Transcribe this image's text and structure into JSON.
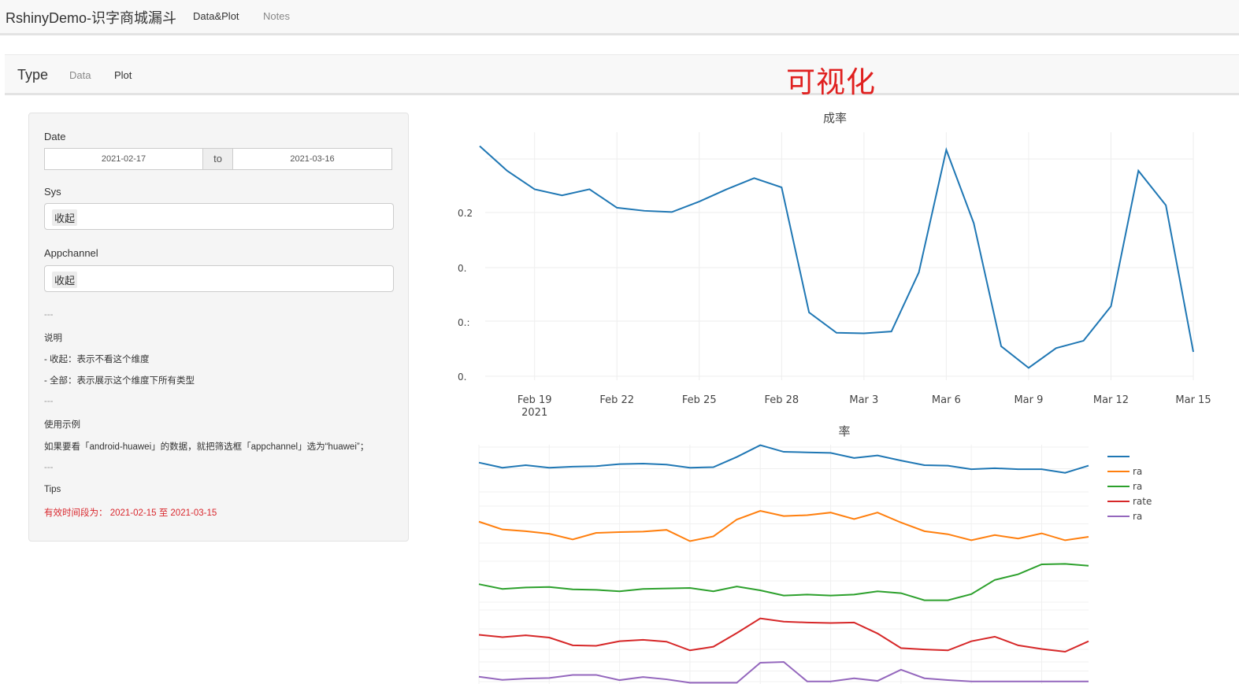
{
  "app": {
    "title": "RshinyDemo-识字商城漏斗",
    "nav": {
      "data_plot": "Data&Plot",
      "notes": "Notes"
    }
  },
  "subnav": {
    "brand": "Type",
    "tabs": {
      "data": "Data",
      "plot": "Plot"
    }
  },
  "page_heading": "可视化",
  "sidebar": {
    "date_label": "Date",
    "date_start": "2021-02-17",
    "date_sep": "to",
    "date_end": "2021-03-16",
    "sys_label": "Sys",
    "sys_value": "收起",
    "appchannel_label": "Appchannel",
    "appchannel_value": "收起",
    "hr1": "---",
    "note_title": "说明",
    "note_line1": "- 收起：表示不看这个维度",
    "note_line2": "- 全部：表示展示这个维度下所有类型",
    "hr2": "---",
    "example_title": "使用示例",
    "example_line": "如果要看「android-huawei」的数据，就把筛选框「appchannel」选为“huawei”；",
    "hr3": "---",
    "tips_title": "Tips",
    "tips_line": "有效时间段为： 2021-02-15 至 2021-03-15"
  },
  "colors": {
    "accent_red": "#e0201f",
    "series_blue": "#1f77b4",
    "series_orange": "#ff7f0e",
    "series_green": "#2ca02c",
    "series_red": "#d62728",
    "series_purple": "#9467bd"
  },
  "chart_data": [
    {
      "type": "line",
      "title": "",
      "title_visible_fragment": "成率",
      "x": [
        "2021-02-17",
        "2021-02-18",
        "2021-02-19",
        "2021-02-20",
        "2021-02-21",
        "2021-02-22",
        "2021-02-23",
        "2021-02-24",
        "2021-02-25",
        "2021-02-26",
        "2021-02-27",
        "2021-02-28",
        "2021-03-01",
        "2021-03-02",
        "2021-03-03",
        "2021-03-04",
        "2021-03-05",
        "2021-03-06",
        "2021-03-07",
        "2021-03-08",
        "2021-03-09",
        "2021-03-10",
        "2021-03-11",
        "2021-03-12",
        "2021-03-13",
        "2021-03-14",
        "2021-03-15"
      ],
      "x_tick_labels": [
        "Feb 19\n2021",
        "Feb 22",
        "Feb 25",
        "Feb 28",
        "Mar 3",
        "Mar 6",
        "Mar 9",
        "Mar 12",
        "Mar 15"
      ],
      "y_tick_labels": [
        "0.2",
        "0.",
        "0.:",
        "0."
      ],
      "series": [
        {
          "color": "#1f77b4",
          "values": [
            0.98,
            0.94,
            0.91,
            0.9,
            0.91,
            0.88,
            0.875,
            0.873,
            0.89,
            0.91,
            0.928,
            0.913,
            0.71,
            0.677,
            0.676,
            0.679,
            0.775,
            0.974,
            0.855,
            0.655,
            0.62,
            0.652,
            0.664,
            0.72,
            0.94,
            0.884,
            0.646
          ]
        }
      ],
      "grid": true
    },
    {
      "type": "line",
      "title": "",
      "title_visible_fragment": "率",
      "x": [
        "2021-02-17",
        "2021-02-18",
        "2021-02-19",
        "2021-02-20",
        "2021-02-21",
        "2021-02-22",
        "2021-02-23",
        "2021-02-24",
        "2021-02-25",
        "2021-02-26",
        "2021-02-27",
        "2021-02-28",
        "2021-03-01",
        "2021-03-02",
        "2021-03-03",
        "2021-03-04",
        "2021-03-05",
        "2021-03-06",
        "2021-03-07",
        "2021-03-08",
        "2021-03-09",
        "2021-03-10",
        "2021-03-11",
        "2021-03-12",
        "2021-03-13",
        "2021-03-14",
        "2021-03-15"
      ],
      "legend_placement": "top-right",
      "legend_fragments": [
        "ra",
        "ra",
        "rate",
        "ra"
      ],
      "subplots": 5,
      "series": [
        {
          "color": "#1f77b4",
          "values": [
            0.62,
            0.52,
            0.57,
            0.52,
            0.54,
            0.55,
            0.59,
            0.6,
            0.58,
            0.52,
            0.53,
            0.73,
            0.96,
            0.83,
            0.82,
            0.81,
            0.71,
            0.76,
            0.66,
            0.57,
            0.56,
            0.49,
            0.51,
            0.49,
            0.49,
            0.42,
            0.56
          ]
        },
        {
          "color": "#ff7f0e",
          "values": [
            0.55,
            0.37,
            0.33,
            0.27,
            0.14,
            0.29,
            0.31,
            0.32,
            0.36,
            0.1,
            0.21,
            0.6,
            0.8,
            0.68,
            0.7,
            0.76,
            0.61,
            0.76,
            0.53,
            0.33,
            0.26,
            0.12,
            0.24,
            0.16,
            0.28,
            0.12,
            0.2
          ]
        },
        {
          "color": "#2ca02c",
          "values": [
            0.43,
            0.33,
            0.36,
            0.37,
            0.32,
            0.31,
            0.28,
            0.33,
            0.34,
            0.35,
            0.28,
            0.38,
            0.3,
            0.19,
            0.21,
            0.19,
            0.21,
            0.28,
            0.24,
            0.09,
            0.09,
            0.22,
            0.52,
            0.64,
            0.85,
            0.86,
            0.82
          ]
        },
        {
          "color": "#d62728",
          "values": [
            0.37,
            0.32,
            0.36,
            0.31,
            0.14,
            0.13,
            0.23,
            0.26,
            0.22,
            0.03,
            0.11,
            0.41,
            0.73,
            0.66,
            0.64,
            0.63,
            0.64,
            0.4,
            0.08,
            0.05,
            0.03,
            0.23,
            0.33,
            0.14,
            0.06,
            0.0,
            0.23
          ]
        },
        {
          "color": "#9467bd",
          "values": [
            0.28,
            0.16,
            0.21,
            0.23,
            0.35,
            0.35,
            0.15,
            0.27,
            0.18,
            0.05,
            0.05,
            0.05,
            0.82,
            0.85,
            0.1,
            0.1,
            0.22,
            0.12,
            0.55,
            0.22,
            0.15,
            0.1,
            0.1,
            0.1,
            0.1,
            0.1,
            0.1
          ]
        }
      ],
      "grid": true
    }
  ]
}
